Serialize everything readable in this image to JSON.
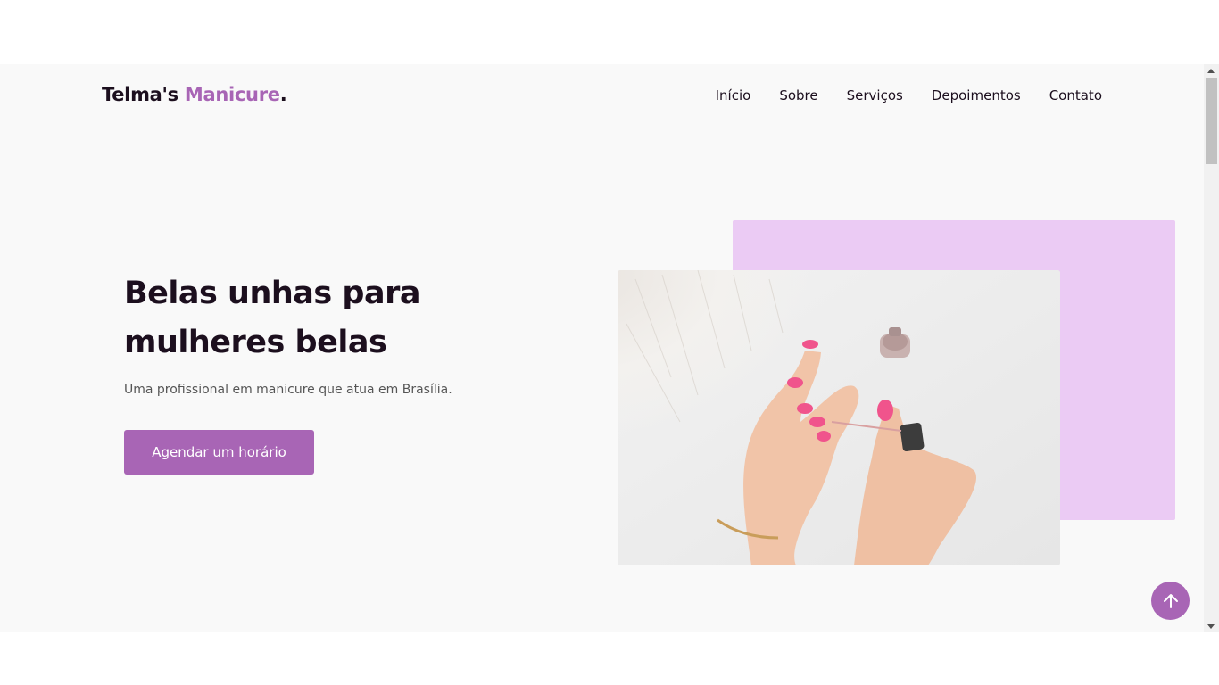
{
  "header": {
    "brand_part1": "Telma's ",
    "brand_part2": "Manicure",
    "brand_part3": ".",
    "nav": [
      {
        "label": "Início"
      },
      {
        "label": "Sobre"
      },
      {
        "label": "Serviços"
      },
      {
        "label": "Depoimentos"
      },
      {
        "label": "Contato"
      }
    ]
  },
  "hero": {
    "title_line1": "Belas unhas para",
    "title_line2": "mulheres belas",
    "subtitle": "Uma profissional em manicure que atua em Brasília.",
    "cta_label": "Agendar um horário",
    "image_alt": "Mãos pintando unhas de rosa"
  },
  "icons": {
    "back_to_top": "arrow-up-icon"
  },
  "colors": {
    "accent": "#a865b5",
    "accent_light": "#ebcbf4",
    "text_dark": "#1c0f1e",
    "background": "#f9f9f9"
  }
}
